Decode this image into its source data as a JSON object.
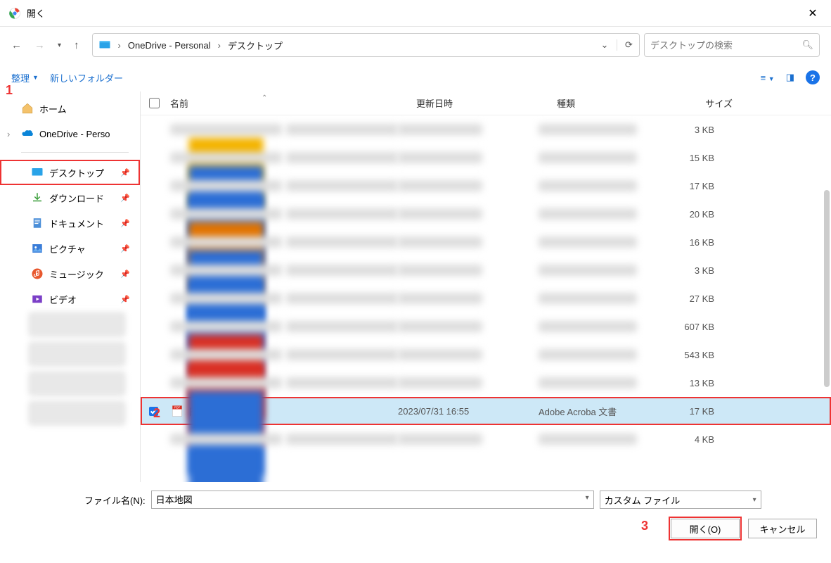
{
  "title": "開く",
  "breadcrumb": {
    "item1": "OneDrive - Personal",
    "item2": "デスクトップ"
  },
  "search": {
    "placeholder": "デスクトップの検索"
  },
  "toolbar": {
    "organize": "整理",
    "new_folder": "新しいフォルダー"
  },
  "sidebar": {
    "home": "ホーム",
    "onedrive": "OneDrive - Perso",
    "desktop": "デスクトップ",
    "downloads": "ダウンロード",
    "documents": "ドキュメント",
    "pictures": "ピクチャ",
    "music": "ミュージック",
    "videos": "ビデオ"
  },
  "columns": {
    "name": "名前",
    "date": "更新日時",
    "type": "種類",
    "size": "サイズ"
  },
  "rows": {
    "blurred_sizes": [
      "3 KB",
      "15 KB",
      "17 KB",
      "20 KB",
      "16 KB",
      "3 KB",
      "27 KB",
      "607 KB",
      "543 KB",
      "13 KB"
    ],
    "selected": {
      "name": "日本地図",
      "date": "2023/07/31 16:55",
      "type": "Adobe Acroba 文書",
      "size": "17 KB"
    },
    "after_size": "4 KB"
  },
  "footer": {
    "filename_label": "ファイル名(N):",
    "filename_value": "日本地図",
    "filter": "カスタム ファイル",
    "open": "開く(O)",
    "cancel": "キャンセル"
  },
  "annotations": {
    "a1": "1",
    "a2": "2",
    "a3": "3"
  }
}
